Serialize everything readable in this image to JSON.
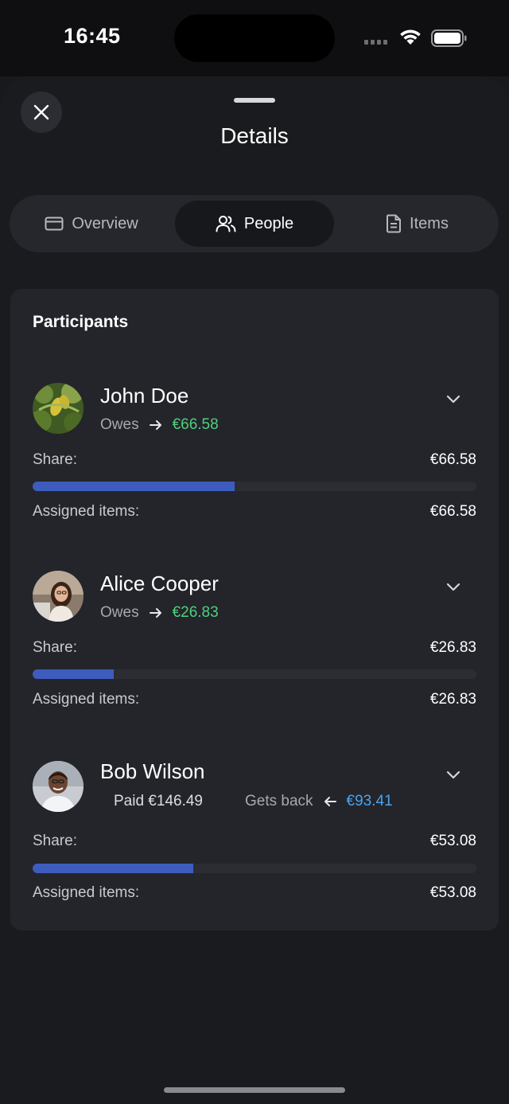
{
  "status_bar": {
    "time": "16:45"
  },
  "sheet": {
    "title": "Details"
  },
  "tabs": [
    {
      "label": "Overview",
      "icon": "card-icon",
      "active": false
    },
    {
      "label": "People",
      "icon": "people-icon",
      "active": true
    },
    {
      "label": "Items",
      "icon": "document-icon",
      "active": false
    }
  ],
  "participants": {
    "title": "Participants",
    "people": [
      {
        "name": "John Doe",
        "status_label": "Owes",
        "status_amount": "€66.58",
        "share_label": "Share:",
        "share_value": "€66.58",
        "share_fraction": 0.455,
        "assigned_label": "Assigned items:",
        "assigned_value": "€66.58"
      },
      {
        "name": "Alice Cooper",
        "status_label": "Owes",
        "status_amount": "€26.83",
        "share_label": "Share:",
        "share_value": "€26.83",
        "share_fraction": 0.183,
        "assigned_label": "Assigned items:",
        "assigned_value": "€26.83"
      },
      {
        "name": "Bob Wilson",
        "paid_text": "Paid €146.49",
        "status_label": "Gets back",
        "status_amount": "€93.41",
        "share_label": "Share:",
        "share_value": "€53.08",
        "share_fraction": 0.362,
        "assigned_label": "Assigned items:",
        "assigned_value": "€53.08"
      }
    ]
  },
  "colors": {
    "owes_amount": "#4fd07a",
    "gets_back_amount": "#4aa3f0",
    "share_bar": "#3d5cbe"
  }
}
